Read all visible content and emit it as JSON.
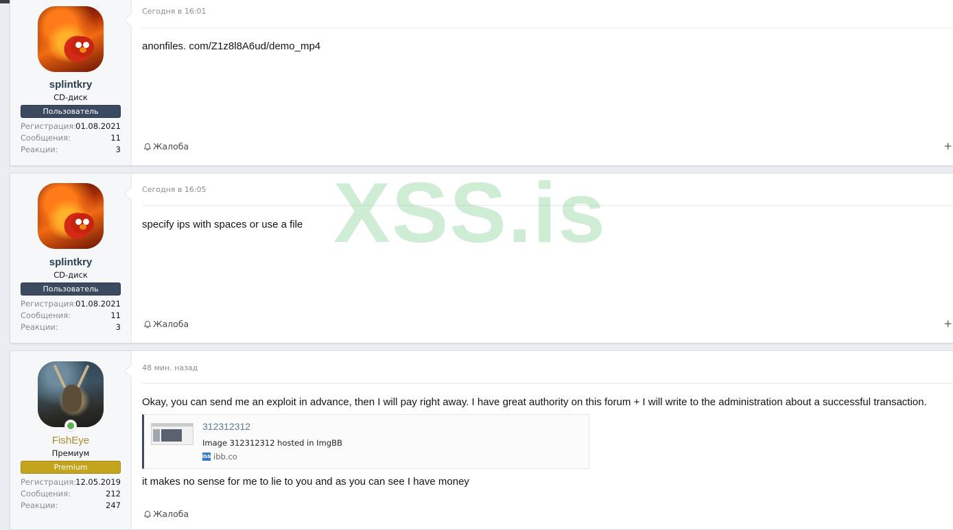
{
  "watermark": "XSS.is",
  "posts": [
    {
      "username": "splintkry",
      "user_title": "CD-диск",
      "badge": "Пользователь",
      "stats": [
        {
          "label": "Регистрация:",
          "value": "01.08.2021"
        },
        {
          "label": "Сообщения:",
          "value": "11"
        },
        {
          "label": "Реакции:",
          "value": "3"
        }
      ],
      "timestamp": "Сегодня в 16:01",
      "message": "anonfiles. com/Z1z8l8A6ud/demo_mp4",
      "report": "Жалоба",
      "plus": "+"
    },
    {
      "username": "splintkry",
      "user_title": "CD-диск",
      "badge": "Пользователь",
      "stats": [
        {
          "label": "Регистрация:",
          "value": "01.08.2021"
        },
        {
          "label": "Сообщения:",
          "value": "11"
        },
        {
          "label": "Реакции:",
          "value": "3"
        }
      ],
      "timestamp": "Сегодня в 16:05",
      "message": "specify ips with spaces or use a file",
      "report": "Жалоба",
      "plus": "+"
    },
    {
      "username": "FishEye",
      "user_title": "Премиум",
      "badge": "Premium",
      "stats": [
        {
          "label": "Регистрация:",
          "value": "12.05.2019"
        },
        {
          "label": "Сообщения:",
          "value": "212"
        },
        {
          "label": "Реакции:",
          "value": "247"
        }
      ],
      "timestamp": "48 мин. назад",
      "message": "Okay, you can send me an exploit in advance, then I will pay right away. I have great authority on this forum + I will write to the administration about a successful transaction.",
      "embed": {
        "title": "312312312",
        "description": "Image 312312312 hosted in ImgBB",
        "site": "ibb.co",
        "favicon_text": "ibb"
      },
      "message2": "it makes no sense for me to lie to you and as you can see I have money",
      "report": "Жалоба"
    }
  ]
}
